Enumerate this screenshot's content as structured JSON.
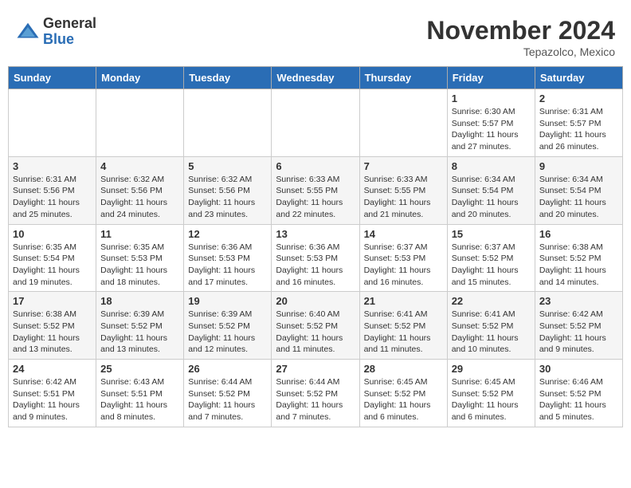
{
  "header": {
    "logo_general": "General",
    "logo_blue": "Blue",
    "month_title": "November 2024",
    "location": "Tepazolco, Mexico"
  },
  "weekdays": [
    "Sunday",
    "Monday",
    "Tuesday",
    "Wednesday",
    "Thursday",
    "Friday",
    "Saturday"
  ],
  "weeks": [
    [
      {
        "day": "",
        "info": ""
      },
      {
        "day": "",
        "info": ""
      },
      {
        "day": "",
        "info": ""
      },
      {
        "day": "",
        "info": ""
      },
      {
        "day": "",
        "info": ""
      },
      {
        "day": "1",
        "info": "Sunrise: 6:30 AM\nSunset: 5:57 PM\nDaylight: 11 hours and 27 minutes."
      },
      {
        "day": "2",
        "info": "Sunrise: 6:31 AM\nSunset: 5:57 PM\nDaylight: 11 hours and 26 minutes."
      }
    ],
    [
      {
        "day": "3",
        "info": "Sunrise: 6:31 AM\nSunset: 5:56 PM\nDaylight: 11 hours and 25 minutes."
      },
      {
        "day": "4",
        "info": "Sunrise: 6:32 AM\nSunset: 5:56 PM\nDaylight: 11 hours and 24 minutes."
      },
      {
        "day": "5",
        "info": "Sunrise: 6:32 AM\nSunset: 5:56 PM\nDaylight: 11 hours and 23 minutes."
      },
      {
        "day": "6",
        "info": "Sunrise: 6:33 AM\nSunset: 5:55 PM\nDaylight: 11 hours and 22 minutes."
      },
      {
        "day": "7",
        "info": "Sunrise: 6:33 AM\nSunset: 5:55 PM\nDaylight: 11 hours and 21 minutes."
      },
      {
        "day": "8",
        "info": "Sunrise: 6:34 AM\nSunset: 5:54 PM\nDaylight: 11 hours and 20 minutes."
      },
      {
        "day": "9",
        "info": "Sunrise: 6:34 AM\nSunset: 5:54 PM\nDaylight: 11 hours and 20 minutes."
      }
    ],
    [
      {
        "day": "10",
        "info": "Sunrise: 6:35 AM\nSunset: 5:54 PM\nDaylight: 11 hours and 19 minutes."
      },
      {
        "day": "11",
        "info": "Sunrise: 6:35 AM\nSunset: 5:53 PM\nDaylight: 11 hours and 18 minutes."
      },
      {
        "day": "12",
        "info": "Sunrise: 6:36 AM\nSunset: 5:53 PM\nDaylight: 11 hours and 17 minutes."
      },
      {
        "day": "13",
        "info": "Sunrise: 6:36 AM\nSunset: 5:53 PM\nDaylight: 11 hours and 16 minutes."
      },
      {
        "day": "14",
        "info": "Sunrise: 6:37 AM\nSunset: 5:53 PM\nDaylight: 11 hours and 16 minutes."
      },
      {
        "day": "15",
        "info": "Sunrise: 6:37 AM\nSunset: 5:52 PM\nDaylight: 11 hours and 15 minutes."
      },
      {
        "day": "16",
        "info": "Sunrise: 6:38 AM\nSunset: 5:52 PM\nDaylight: 11 hours and 14 minutes."
      }
    ],
    [
      {
        "day": "17",
        "info": "Sunrise: 6:38 AM\nSunset: 5:52 PM\nDaylight: 11 hours and 13 minutes."
      },
      {
        "day": "18",
        "info": "Sunrise: 6:39 AM\nSunset: 5:52 PM\nDaylight: 11 hours and 13 minutes."
      },
      {
        "day": "19",
        "info": "Sunrise: 6:39 AM\nSunset: 5:52 PM\nDaylight: 11 hours and 12 minutes."
      },
      {
        "day": "20",
        "info": "Sunrise: 6:40 AM\nSunset: 5:52 PM\nDaylight: 11 hours and 11 minutes."
      },
      {
        "day": "21",
        "info": "Sunrise: 6:41 AM\nSunset: 5:52 PM\nDaylight: 11 hours and 11 minutes."
      },
      {
        "day": "22",
        "info": "Sunrise: 6:41 AM\nSunset: 5:52 PM\nDaylight: 11 hours and 10 minutes."
      },
      {
        "day": "23",
        "info": "Sunrise: 6:42 AM\nSunset: 5:52 PM\nDaylight: 11 hours and 9 minutes."
      }
    ],
    [
      {
        "day": "24",
        "info": "Sunrise: 6:42 AM\nSunset: 5:51 PM\nDaylight: 11 hours and 9 minutes."
      },
      {
        "day": "25",
        "info": "Sunrise: 6:43 AM\nSunset: 5:51 PM\nDaylight: 11 hours and 8 minutes."
      },
      {
        "day": "26",
        "info": "Sunrise: 6:44 AM\nSunset: 5:52 PM\nDaylight: 11 hours and 7 minutes."
      },
      {
        "day": "27",
        "info": "Sunrise: 6:44 AM\nSunset: 5:52 PM\nDaylight: 11 hours and 7 minutes."
      },
      {
        "day": "28",
        "info": "Sunrise: 6:45 AM\nSunset: 5:52 PM\nDaylight: 11 hours and 6 minutes."
      },
      {
        "day": "29",
        "info": "Sunrise: 6:45 AM\nSunset: 5:52 PM\nDaylight: 11 hours and 6 minutes."
      },
      {
        "day": "30",
        "info": "Sunrise: 6:46 AM\nSunset: 5:52 PM\nDaylight: 11 hours and 5 minutes."
      }
    ]
  ]
}
